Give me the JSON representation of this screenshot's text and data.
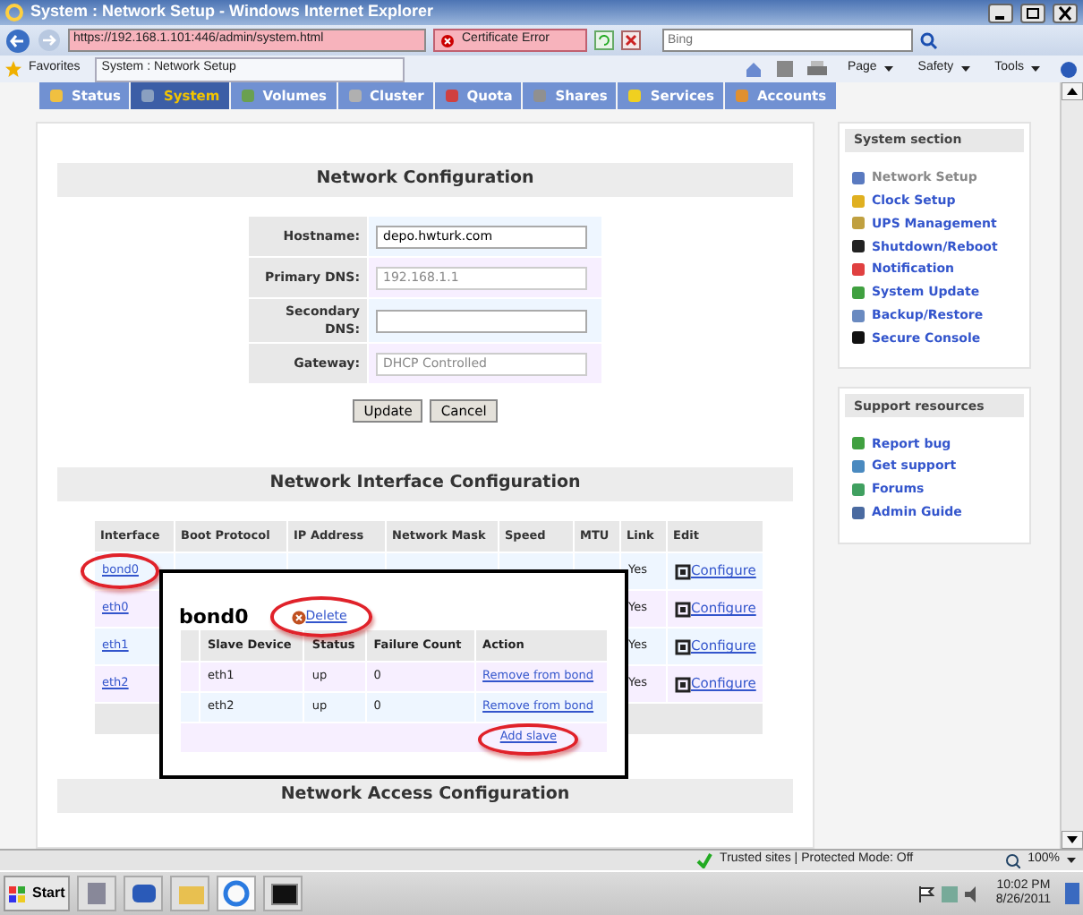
{
  "window": {
    "title": "System : Network Setup - Windows Internet Explorer"
  },
  "address_bar": {
    "url": "https://192.168.1.101:446/admin/system.html",
    "certificate_error": "Certificate Error",
    "search": {
      "placeholder": "Bing"
    }
  },
  "favorites_bar": {
    "favorites": "Favorites",
    "tabs": [
      {
        "title": "System : Network Setup"
      }
    ],
    "commands": [
      "Page",
      "Safety",
      "Tools"
    ]
  },
  "nav_tabs": [
    {
      "label": "Status",
      "selected": false
    },
    {
      "label": "System",
      "selected": true
    },
    {
      "label": "Volumes",
      "selected": false
    },
    {
      "label": "Cluster",
      "selected": false
    },
    {
      "label": "Quota",
      "selected": false
    },
    {
      "label": "Shares",
      "selected": false
    },
    {
      "label": "Services",
      "selected": false
    },
    {
      "label": "Accounts",
      "selected": false
    }
  ],
  "network_configuration": {
    "title": "Network Configuration",
    "fields": [
      {
        "label": "Hostname:",
        "value": "depo.hwturk.com",
        "disabled": false
      },
      {
        "label": "Primary DNS:",
        "value": "192.168.1.1",
        "disabled": true
      },
      {
        "label": "Secondary DNS:",
        "disabled": false
      },
      {
        "label": "Gateway:",
        "value": "DHCP Controlled",
        "disabled": true
      }
    ],
    "buttons": [
      "Update",
      "Cancel"
    ]
  },
  "interface_configuration": {
    "title": "Network Interface Configuration",
    "columns": [
      "Interface",
      "Boot Protocol",
      "IP Address",
      "Network Mask",
      "Speed",
      "MTU",
      "Link",
      "Edit"
    ],
    "rows": [
      {
        "interface": "bond0",
        "link": "Yes",
        "edit": "Configure"
      },
      {
        "interface": "eth0",
        "link": "Yes",
        "edit": "Configure"
      },
      {
        "interface": "eth1",
        "link": "Yes",
        "edit": "Configure"
      },
      {
        "interface": "eth2",
        "link": "Yes",
        "edit": "Configure"
      }
    ]
  },
  "bond_popup": {
    "title": "bond0",
    "delete": "Delete",
    "columns": [
      "Slave Device",
      "Status",
      "Failure Count",
      "Action"
    ],
    "rows": [
      {
        "device": "eth1",
        "status": "up",
        "failure_count": "0",
        "action": "Remove from bond"
      },
      {
        "device": "eth2",
        "status": "up",
        "failure_count": "0",
        "action": "Remove from bond"
      }
    ],
    "add": "Add slave"
  },
  "access_configuration": {
    "title": "Network Access Configuration"
  },
  "sidebar": [
    {
      "title": "System section",
      "items": [
        {
          "label": "Network Setup",
          "selected": true
        },
        {
          "label": "Clock Setup",
          "selected": false
        },
        {
          "label": "UPS Management",
          "selected": false
        },
        {
          "label": "Shutdown/Reboot",
          "selected": false
        },
        {
          "label": "Notification",
          "selected": false
        },
        {
          "label": "System Update",
          "selected": false
        },
        {
          "label": "Backup/Restore",
          "selected": false
        },
        {
          "label": "Secure Console",
          "selected": false
        }
      ]
    },
    {
      "title": "Support resources",
      "items": [
        {
          "label": "Report bug",
          "selected": false
        },
        {
          "label": "Get support",
          "selected": false
        },
        {
          "label": "Forums",
          "selected": false
        },
        {
          "label": "Admin Guide",
          "selected": false
        }
      ]
    }
  ],
  "status_bar": {
    "zone": "Trusted sites | Protected Mode: Off",
    "zoom": "100%"
  },
  "taskbar": {
    "start": "Start",
    "time": "10:02 PM",
    "date": "8/26/2011"
  }
}
